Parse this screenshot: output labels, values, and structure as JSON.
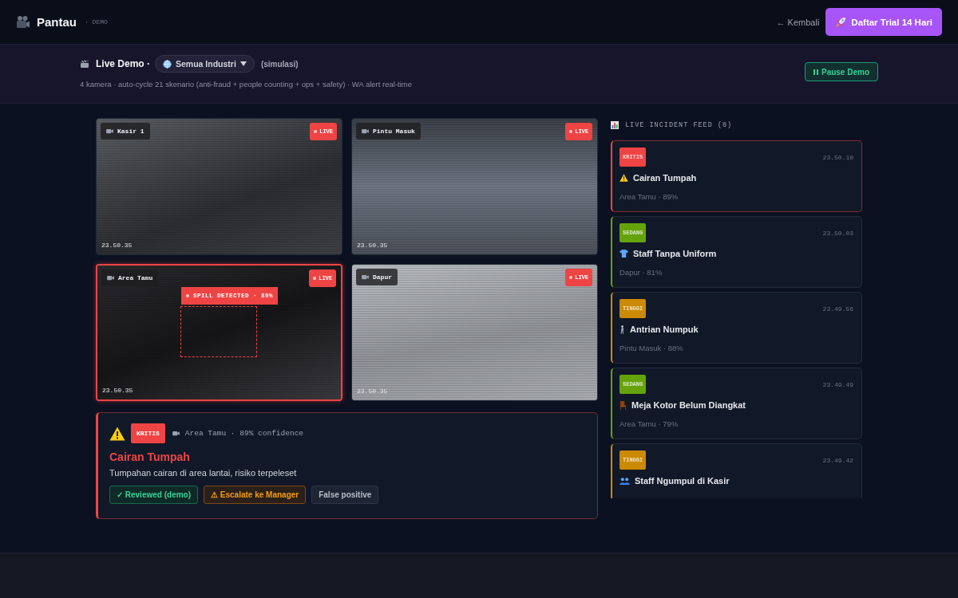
{
  "header": {
    "brand": "Pantau",
    "tag": "· DEMO",
    "back_link": "← Kembali",
    "cta_button": "Daftar Trial 14 Hari"
  },
  "demo_bar": {
    "title": "Live Demo ·",
    "industry_dropdown": "Semua Industri",
    "note": "(simulasi)",
    "description": "4 kamera · auto-cycle 21 skenario (anti-fraud + people counting + ops + safety) · WA alert real-time",
    "pause_button": "Pause Demo"
  },
  "cameras": [
    {
      "name": "Kasir 1",
      "live_badge": "LIVE",
      "timestamp": "23.50.35",
      "alert": false
    },
    {
      "name": "Pintu Masuk",
      "live_badge": "LIVE",
      "timestamp": "23.50.35",
      "alert": false
    },
    {
      "name": "Area Tamu",
      "live_badge": "LIVE",
      "timestamp": "23.50.35",
      "alert": true,
      "detection": "SPILL DETECTED · 89%"
    },
    {
      "name": "Dapur",
      "live_badge": "LIVE",
      "timestamp": "23.50.35",
      "alert": false
    }
  ],
  "alert_panel": {
    "severity": "KRITIS",
    "location": "Area Tamu · 89% confidence",
    "title": "Cairan Tumpah",
    "description": "Tumpahan cairan di area lantai, risiko terpeleset",
    "actions": [
      {
        "label": "✓ Reviewed (demo)",
        "kind": "confirm"
      },
      {
        "label": "⚠ Escalate ke Manager",
        "kind": "escalate"
      },
      {
        "label": "False positive",
        "kind": "dismiss"
      }
    ]
  },
  "incident_feed": {
    "title": "LIVE INCIDENT FEED (8)",
    "items": [
      {
        "severity": "KRITIS",
        "color": "#ef4444",
        "time": "23.50.10",
        "kind": "spill",
        "title": "Cairan Tumpah",
        "meta": "Area Tamu · 89%",
        "selected": true
      },
      {
        "severity": "SEDANG",
        "color": "#65a30d",
        "time": "23.50.03",
        "kind": "uniform",
        "title": "Staff Tanpa Uniform",
        "meta": "Dapur · 81%",
        "selected": false
      },
      {
        "severity": "TINGGI",
        "color": "#ca8a04",
        "time": "23.49.56",
        "kind": "queue",
        "title": "Antrian Numpuk",
        "meta": "Pintu Masuk · 88%",
        "selected": false
      },
      {
        "severity": "SEDANG",
        "color": "#65a30d",
        "time": "23.49.49",
        "kind": "table",
        "title": "Meja Kotor Belum Diangkat",
        "meta": "Area Tamu · 79%",
        "selected": false
      },
      {
        "severity": "TINGGI",
        "color": "#ca8a04",
        "time": "23.49.42",
        "kind": "crowd",
        "title": "Staff Ngumpul di Kasir",
        "selected": false
      }
    ]
  }
}
